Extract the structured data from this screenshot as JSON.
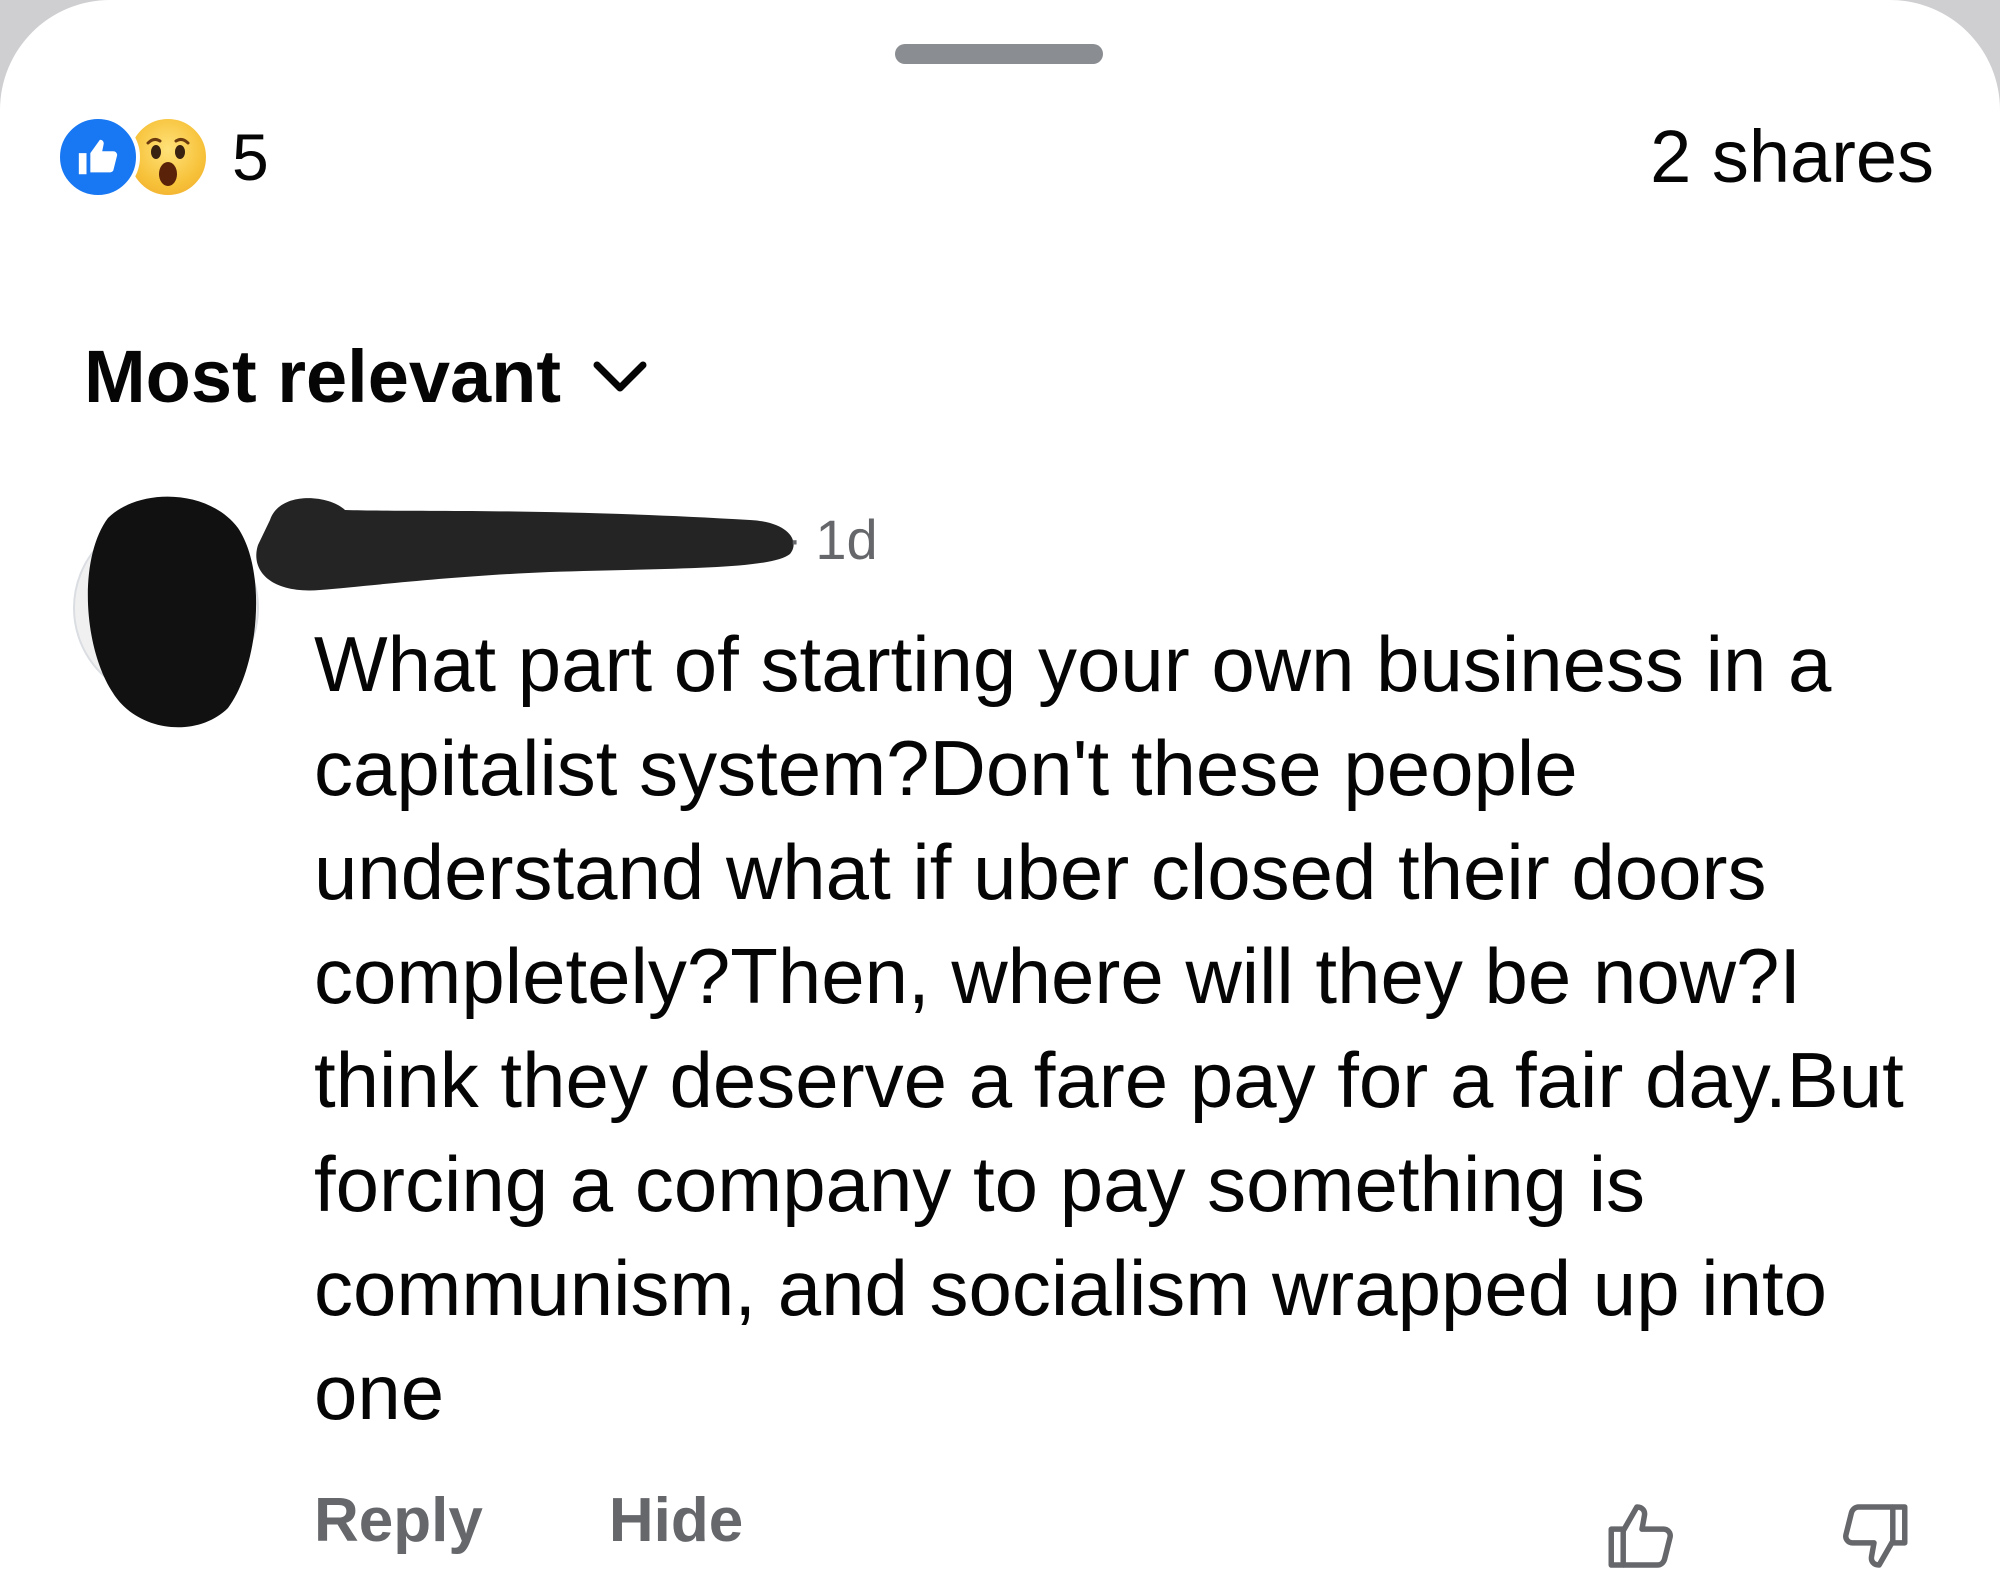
{
  "reactions": {
    "icons": [
      "like-icon",
      "wow-icon"
    ],
    "count": "5"
  },
  "shares_label": "2 shares",
  "sort": {
    "label": "Most relevant",
    "icon": "chevron-down-icon"
  },
  "comment": {
    "time": "1d",
    "text": "What part of starting your own business in a capitalist system?Don't these people understand what if uber closed their doors completely?Then, where will they be now?I think they deserve a fare pay for a fair day.But forcing a company to pay something is communism, and socialism wrapped up into one",
    "actions": {
      "reply": "Reply",
      "hide": "Hide"
    }
  },
  "colors": {
    "like_blue": "#1877f2",
    "secondary_text": "#65676b",
    "primary_text": "#050505",
    "redaction": "#000000"
  }
}
